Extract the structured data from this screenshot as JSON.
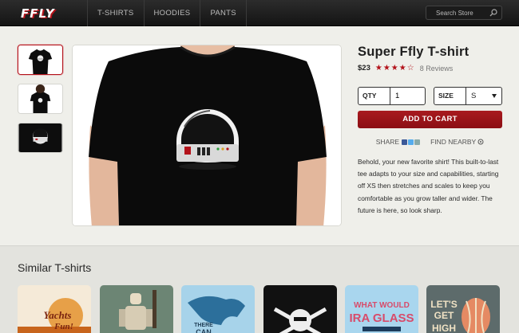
{
  "header": {
    "logo_text": "FFLY",
    "nav": [
      "T-SHIRTS",
      "HOODIES",
      "PANTS"
    ],
    "search_placeholder": "Search Store"
  },
  "product": {
    "title": "Super Ffly T-shirt",
    "price": "$23",
    "rating": 4.5,
    "stars_display": "★★★★☆",
    "reviews": "8 Reviews",
    "qty_label": "QTY",
    "qty_value": "1",
    "size_label": "SIZE",
    "size_value": "S",
    "add_to_cart": "ADD TO CART",
    "share_label": "SHARE",
    "find_nearby": "FIND NEARBY",
    "description": "Behold, your new favorite shirt! This built-to-last tee adapts to your size and capabilities, starting off XS then stretches and scales to keep you comfortable as you grow taller and wider. The future is here, so look sharp."
  },
  "similar": {
    "title": "Similar T-shirts",
    "cards": [
      {
        "name": "yachts",
        "text": "Yachts Fun!"
      },
      {
        "name": "robot-woman",
        "text": ""
      },
      {
        "name": "there-can",
        "text": "THERE CAN"
      },
      {
        "name": "skull",
        "text": ""
      },
      {
        "name": "ira-glass",
        "text": "WHAT WOULD IRA GLASS DO?"
      },
      {
        "name": "lets-get-high",
        "text": "LET'S GET HIGH"
      }
    ]
  },
  "colors": {
    "accent": "#b3121a",
    "cart_button": "#9a151a",
    "nav_bg": "#1e1e1e",
    "page_bg": "#efefea"
  },
  "icons": [
    "search-icon",
    "star-icon",
    "facebook-icon",
    "twitter-icon",
    "email-icon",
    "location-icon",
    "chevron-down-icon"
  ]
}
